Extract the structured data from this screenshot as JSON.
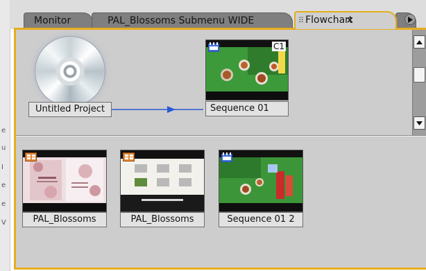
{
  "tabs": [
    {
      "label": "Monitor",
      "active": false
    },
    {
      "label": "PAL_Blossoms Submenu WIDE",
      "active": false
    },
    {
      "label": "Flowchart",
      "active": true
    }
  ],
  "close_glyph": "×",
  "scroll_icons": {
    "tabs_right": "play-right-icon",
    "up": "arrow-up-icon",
    "down": "arrow-down-icon"
  },
  "flowchart": {
    "project_label": "Untitled Project",
    "project_icon": "disc-icon",
    "sequence": {
      "label": "Sequence 01",
      "tag": "C1"
    }
  },
  "unconnected": [
    {
      "label": "PAL_Blossoms",
      "kind": "menu"
    },
    {
      "label": "PAL_Blossoms",
      "kind": "menu"
    },
    {
      "label": "Sequence 01 2",
      "kind": "timeline"
    }
  ],
  "colors": {
    "active_tab_border": "#e6ad1f",
    "connector": "#2a5ad6",
    "panel_bg": "#cdcdcd"
  }
}
